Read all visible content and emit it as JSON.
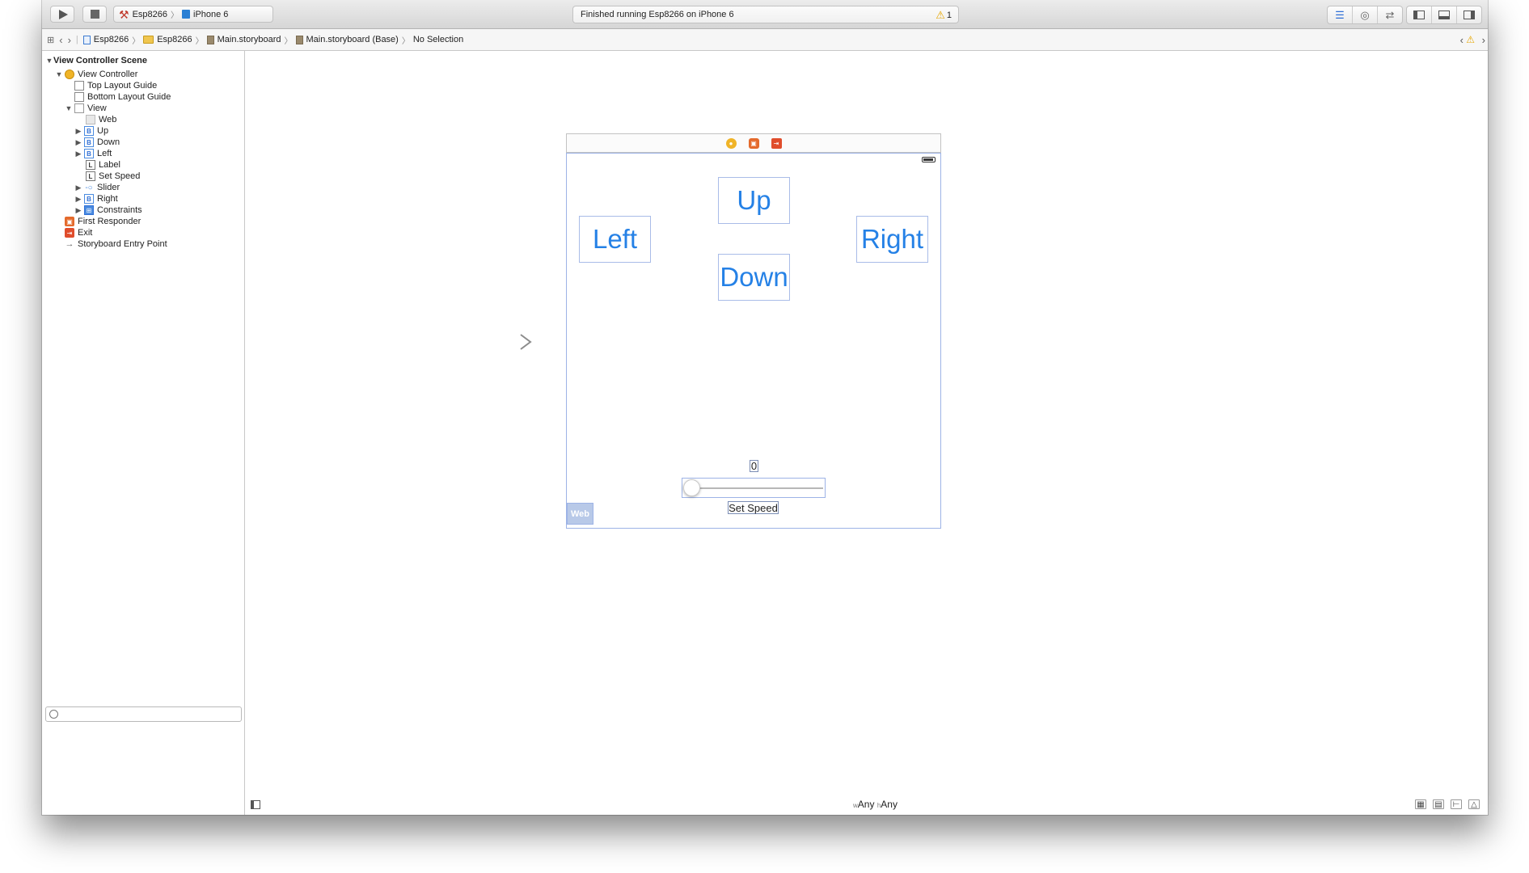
{
  "toolbar": {
    "scheme": {
      "target": "Esp8266",
      "device": "iPhone 6"
    },
    "activity": {
      "status": "Finished running Esp8266 on iPhone 6",
      "warning_count": "1"
    },
    "editor_modes": [
      "standard-editor-icon",
      "assistant-editor-icon",
      "version-editor-icon"
    ],
    "panes": [
      "navigator-pane-icon",
      "debug-pane-icon",
      "utilities-pane-icon"
    ]
  },
  "jumpbar": {
    "items": [
      {
        "label": "Esp8266",
        "icon": "project-file-icon"
      },
      {
        "label": "Esp8266",
        "icon": "folder-icon"
      },
      {
        "label": "Main.storyboard",
        "icon": "storyboard-file-icon"
      },
      {
        "label": "Main.storyboard (Base)",
        "icon": "storyboard-file-icon"
      },
      {
        "label": "No Selection",
        "icon": ""
      }
    ]
  },
  "outline": {
    "items": [
      {
        "label": "View Controller Scene",
        "icon": "scene"
      },
      {
        "label": "View Controller",
        "icon": "vc"
      },
      {
        "label": "Top Layout Guide",
        "icon": "guide"
      },
      {
        "label": "Bottom Layout Guide",
        "icon": "guide"
      },
      {
        "label": "View",
        "icon": "view"
      },
      {
        "label": "Web",
        "icon": "web"
      },
      {
        "label": "Up",
        "icon": "btn",
        "badge": "B"
      },
      {
        "label": "Down",
        "icon": "btn",
        "badge": "B"
      },
      {
        "label": "Left",
        "icon": "btn",
        "badge": "B"
      },
      {
        "label": "Label",
        "icon": "lbl",
        "badge": "L"
      },
      {
        "label": "Set Speed",
        "icon": "lbl",
        "badge": "L"
      },
      {
        "label": "Slider",
        "icon": "slider"
      },
      {
        "label": "Right",
        "icon": "btn",
        "badge": "B"
      },
      {
        "label": "Constraints",
        "icon": "cons"
      },
      {
        "label": "First Responder",
        "icon": "fr"
      },
      {
        "label": "Exit",
        "icon": "exit"
      },
      {
        "label": "Storyboard Entry Point",
        "icon": "entry"
      }
    ],
    "filter_placeholder": ""
  },
  "scene": {
    "buttons": {
      "up": "Up",
      "down": "Down",
      "left": "Left",
      "right": "Right"
    },
    "speed_value": "0",
    "slider_value": 0.0,
    "set_speed_label": "Set Speed",
    "web_label": "Web"
  },
  "bottombar": {
    "size_class_w_prefix": "w",
    "size_class_w": "Any",
    "size_class_h_prefix": "h",
    "size_class_h": "Any"
  },
  "colors": {
    "button_text": "#2581e6",
    "selection_border": "#9db3e6",
    "warning": "#e6a600"
  }
}
